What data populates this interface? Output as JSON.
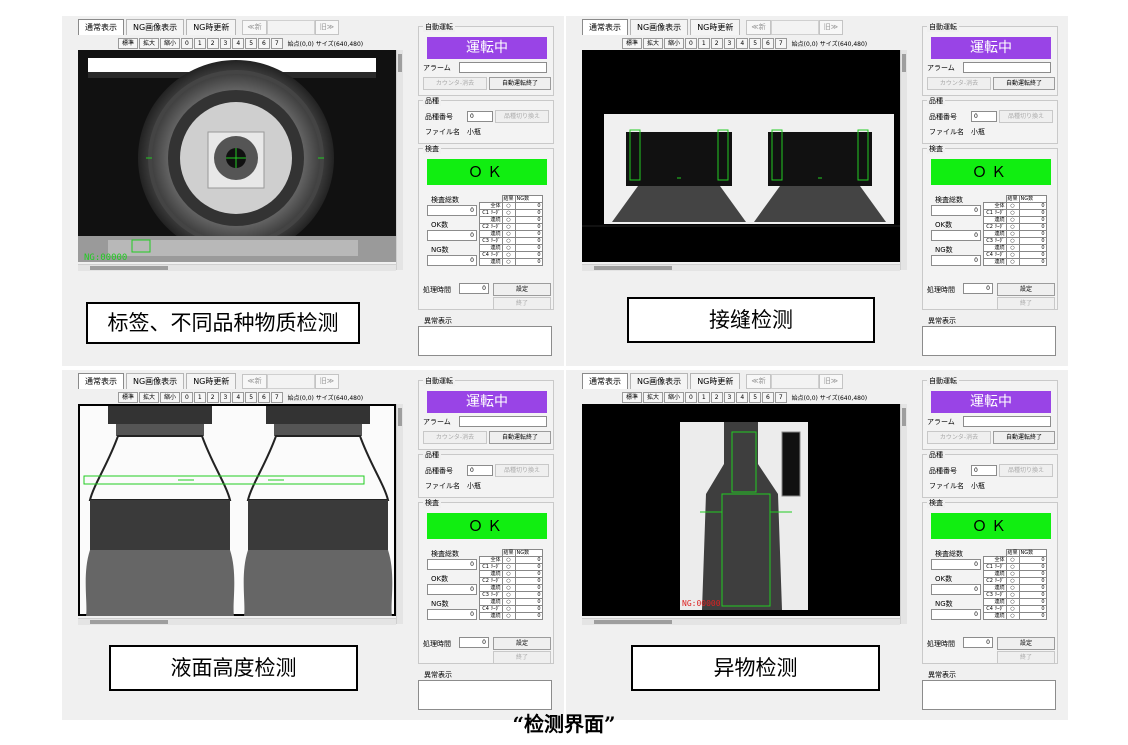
{
  "caption": "“检测界面”",
  "ui": {
    "tabs": [
      "通常表示",
      "NG画像表示",
      "NG時更新"
    ],
    "nav_new": "≪新",
    "nav_old": "旧≫",
    "toolbar": [
      "標準",
      "拡大",
      "縮小",
      "0",
      "1",
      "2",
      "3",
      "4",
      "5",
      "6",
      "7"
    ],
    "coord_text": "始点(0,0) サイズ(640,480)",
    "auto_run_title": "自動運転",
    "running": "運転中",
    "alarm_label": "アラーム",
    "counter_clear": "カウンタ-消去",
    "auto_run_end": "自動運転終了",
    "product_title": "品種",
    "product_no_label": "品種番号",
    "product_no_value": "0",
    "product_switch": "品種切り換え",
    "file_name_label": "ファイル名",
    "file_name_value": "小瓶",
    "inspect_title": "検査",
    "ok": "ＯＫ",
    "total_label": "検査総数",
    "ok_count_label": "OK数",
    "ng_count_label": "NG数",
    "total_value": "0",
    "ok_value": "0",
    "ng_value": "0",
    "result_header": "結果",
    "ng_header": "NG数",
    "result_rows": [
      {
        "name": "全体",
        "ng": "0"
      },
      {
        "name": "C1 ﾘｰﾀﾞ",
        "ng": "0"
      },
      {
        "name": "連続",
        "ng": "0"
      },
      {
        "name": "C2 ﾘｰﾀﾞ",
        "ng": "0"
      },
      {
        "name": "連続",
        "ng": "0"
      },
      {
        "name": "C3 ﾘｰﾀﾞ",
        "ng": "0"
      },
      {
        "name": "連続",
        "ng": "0"
      },
      {
        "name": "C4 ﾘｰﾀﾞ",
        "ng": "0"
      },
      {
        "name": "連続",
        "ng": "0"
      }
    ],
    "process_time_label": "処理時間",
    "process_time_value": "0",
    "settings_button": "設定",
    "end_button": "終了",
    "abnormal_title": "異常表示"
  },
  "panels": [
    {
      "id": "p1",
      "caption": "标签、不同品种物质检测",
      "overlay_text": "NG:00000"
    },
    {
      "id": "p2",
      "caption": "接缝检测"
    },
    {
      "id": "p3",
      "caption": "液面高度检测"
    },
    {
      "id": "p4",
      "caption": "异物检测",
      "overlay_text": "NG:00000"
    }
  ],
  "colors": {
    "running_bg": "#9944e6",
    "ok_bg": "#11ee11",
    "panel_bg": "#f0f0f0",
    "overlay_green": "#22cc22"
  }
}
